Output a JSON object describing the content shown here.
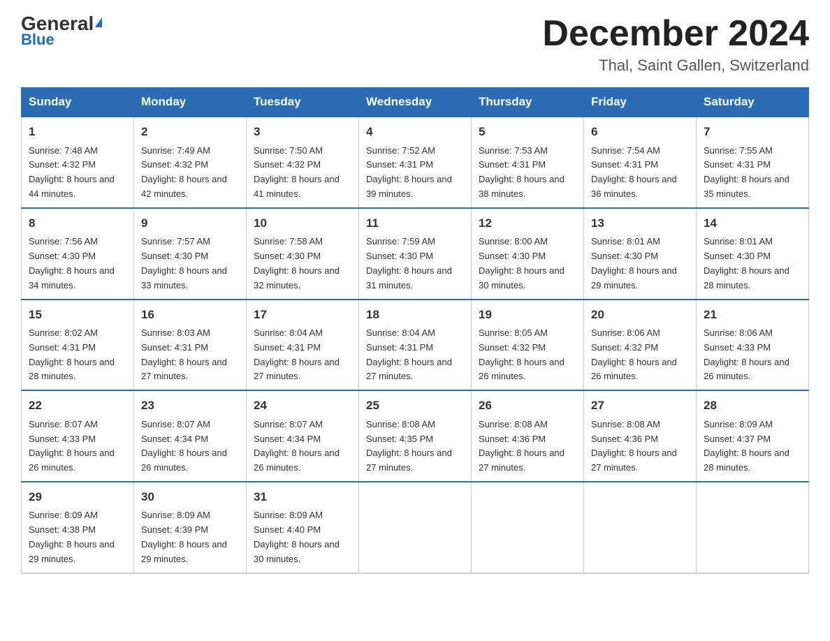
{
  "logo": {
    "brand": "General",
    "brand_blue": "Blue"
  },
  "title": "December 2024",
  "subtitle": "Thal, Saint Gallen, Switzerland",
  "days_of_week": [
    "Sunday",
    "Monday",
    "Tuesday",
    "Wednesday",
    "Thursday",
    "Friday",
    "Saturday"
  ],
  "weeks": [
    [
      {
        "day": "1",
        "sunrise": "7:48 AM",
        "sunset": "4:32 PM",
        "daylight": "8 hours and 44 minutes."
      },
      {
        "day": "2",
        "sunrise": "7:49 AM",
        "sunset": "4:32 PM",
        "daylight": "8 hours and 42 minutes."
      },
      {
        "day": "3",
        "sunrise": "7:50 AM",
        "sunset": "4:32 PM",
        "daylight": "8 hours and 41 minutes."
      },
      {
        "day": "4",
        "sunrise": "7:52 AM",
        "sunset": "4:31 PM",
        "daylight": "8 hours and 39 minutes."
      },
      {
        "day": "5",
        "sunrise": "7:53 AM",
        "sunset": "4:31 PM",
        "daylight": "8 hours and 38 minutes."
      },
      {
        "day": "6",
        "sunrise": "7:54 AM",
        "sunset": "4:31 PM",
        "daylight": "8 hours and 36 minutes."
      },
      {
        "day": "7",
        "sunrise": "7:55 AM",
        "sunset": "4:31 PM",
        "daylight": "8 hours and 35 minutes."
      }
    ],
    [
      {
        "day": "8",
        "sunrise": "7:56 AM",
        "sunset": "4:30 PM",
        "daylight": "8 hours and 34 minutes."
      },
      {
        "day": "9",
        "sunrise": "7:57 AM",
        "sunset": "4:30 PM",
        "daylight": "8 hours and 33 minutes."
      },
      {
        "day": "10",
        "sunrise": "7:58 AM",
        "sunset": "4:30 PM",
        "daylight": "8 hours and 32 minutes."
      },
      {
        "day": "11",
        "sunrise": "7:59 AM",
        "sunset": "4:30 PM",
        "daylight": "8 hours and 31 minutes."
      },
      {
        "day": "12",
        "sunrise": "8:00 AM",
        "sunset": "4:30 PM",
        "daylight": "8 hours and 30 minutes."
      },
      {
        "day": "13",
        "sunrise": "8:01 AM",
        "sunset": "4:30 PM",
        "daylight": "8 hours and 29 minutes."
      },
      {
        "day": "14",
        "sunrise": "8:01 AM",
        "sunset": "4:30 PM",
        "daylight": "8 hours and 28 minutes."
      }
    ],
    [
      {
        "day": "15",
        "sunrise": "8:02 AM",
        "sunset": "4:31 PM",
        "daylight": "8 hours and 28 minutes."
      },
      {
        "day": "16",
        "sunrise": "8:03 AM",
        "sunset": "4:31 PM",
        "daylight": "8 hours and 27 minutes."
      },
      {
        "day": "17",
        "sunrise": "8:04 AM",
        "sunset": "4:31 PM",
        "daylight": "8 hours and 27 minutes."
      },
      {
        "day": "18",
        "sunrise": "8:04 AM",
        "sunset": "4:31 PM",
        "daylight": "8 hours and 27 minutes."
      },
      {
        "day": "19",
        "sunrise": "8:05 AM",
        "sunset": "4:32 PM",
        "daylight": "8 hours and 26 minutes."
      },
      {
        "day": "20",
        "sunrise": "8:06 AM",
        "sunset": "4:32 PM",
        "daylight": "8 hours and 26 minutes."
      },
      {
        "day": "21",
        "sunrise": "8:06 AM",
        "sunset": "4:33 PM",
        "daylight": "8 hours and 26 minutes."
      }
    ],
    [
      {
        "day": "22",
        "sunrise": "8:07 AM",
        "sunset": "4:33 PM",
        "daylight": "8 hours and 26 minutes."
      },
      {
        "day": "23",
        "sunrise": "8:07 AM",
        "sunset": "4:34 PM",
        "daylight": "8 hours and 26 minutes."
      },
      {
        "day": "24",
        "sunrise": "8:07 AM",
        "sunset": "4:34 PM",
        "daylight": "8 hours and 26 minutes."
      },
      {
        "day": "25",
        "sunrise": "8:08 AM",
        "sunset": "4:35 PM",
        "daylight": "8 hours and 27 minutes."
      },
      {
        "day": "26",
        "sunrise": "8:08 AM",
        "sunset": "4:36 PM",
        "daylight": "8 hours and 27 minutes."
      },
      {
        "day": "27",
        "sunrise": "8:08 AM",
        "sunset": "4:36 PM",
        "daylight": "8 hours and 27 minutes."
      },
      {
        "day": "28",
        "sunrise": "8:09 AM",
        "sunset": "4:37 PM",
        "daylight": "8 hours and 28 minutes."
      }
    ],
    [
      {
        "day": "29",
        "sunrise": "8:09 AM",
        "sunset": "4:38 PM",
        "daylight": "8 hours and 29 minutes."
      },
      {
        "day": "30",
        "sunrise": "8:09 AM",
        "sunset": "4:39 PM",
        "daylight": "8 hours and 29 minutes."
      },
      {
        "day": "31",
        "sunrise": "8:09 AM",
        "sunset": "4:40 PM",
        "daylight": "8 hours and 30 minutes."
      },
      null,
      null,
      null,
      null
    ]
  ]
}
